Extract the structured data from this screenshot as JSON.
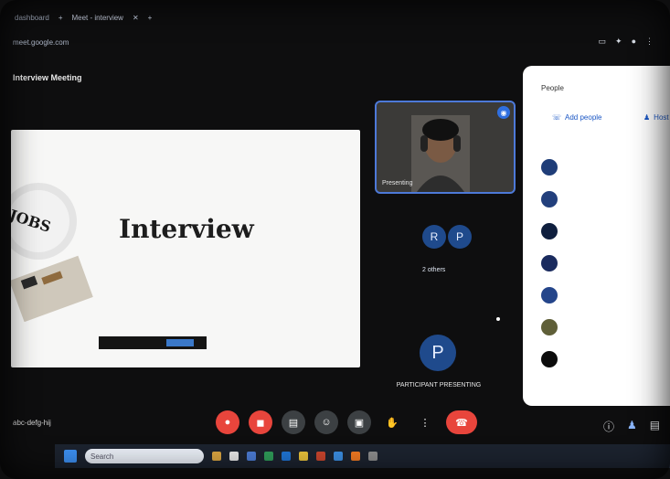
{
  "browser": {
    "tabs": [
      "dashboard",
      "Meet - interview",
      "",
      ""
    ],
    "url": "meet.google.com",
    "toolbar_icons": [
      "cast-icon",
      "extensions-icon",
      "profile-icon",
      "menu-icon"
    ]
  },
  "meeting": {
    "title": "Interview Meeting",
    "slide": {
      "title": "Interview",
      "side_text": "JOBS"
    },
    "presenter_tile": {
      "name": "Presenting"
    },
    "others_label": "2 others",
    "participant_initials": [
      "R",
      "P"
    ],
    "big_participant": {
      "initial": "P",
      "name": "PARTICIPANT PRESENTING"
    },
    "meeting_code": "abc-defg-hij"
  },
  "people_panel": {
    "title": "People",
    "add_people_label": "Add people",
    "host_controls_label": "Host",
    "participants": [
      {
        "name": "",
        "color": "#1f3d78"
      },
      {
        "name": "",
        "color": "#223f7c"
      },
      {
        "name": "",
        "color": "#0f1f3e"
      },
      {
        "name": "",
        "color": "#1a2b5e"
      },
      {
        "name": "",
        "color": "#24458a"
      },
      {
        "name": "",
        "color": "#5f5f38"
      },
      {
        "name": "",
        "color": "#0c0c0c"
      }
    ]
  },
  "controls": {
    "buttons": [
      {
        "name": "mic-off-button",
        "icon": "mic-off-icon",
        "glyph": "●",
        "style": "red"
      },
      {
        "name": "camera-off-button",
        "icon": "camera-off-icon",
        "glyph": "◼",
        "style": "red"
      },
      {
        "name": "captions-button",
        "icon": "captions-icon",
        "glyph": "▤",
        "style": ""
      },
      {
        "name": "emoji-button",
        "icon": "emoji-icon",
        "glyph": "☺",
        "style": ""
      },
      {
        "name": "present-button",
        "icon": "present-icon",
        "glyph": "▣",
        "style": ""
      },
      {
        "name": "raise-hand-button",
        "icon": "hand-icon",
        "glyph": "✋",
        "style": "plain"
      },
      {
        "name": "more-options-button",
        "icon": "more-vert-icon",
        "glyph": "⋮",
        "style": "plain"
      }
    ],
    "end_call_glyph": "☎",
    "right_icons": [
      "info-icon",
      "people-icon",
      "chat-icon"
    ]
  },
  "taskbar": {
    "search_placeholder": "Search",
    "app_colors": [
      "#d9a441",
      "#e6e6e6",
      "#4b7bd3",
      "#2f9b58",
      "#1f74d4",
      "#e8c13a",
      "#c8452d",
      "#3b8de0",
      "#f07a22",
      "#8c8c8c"
    ]
  }
}
